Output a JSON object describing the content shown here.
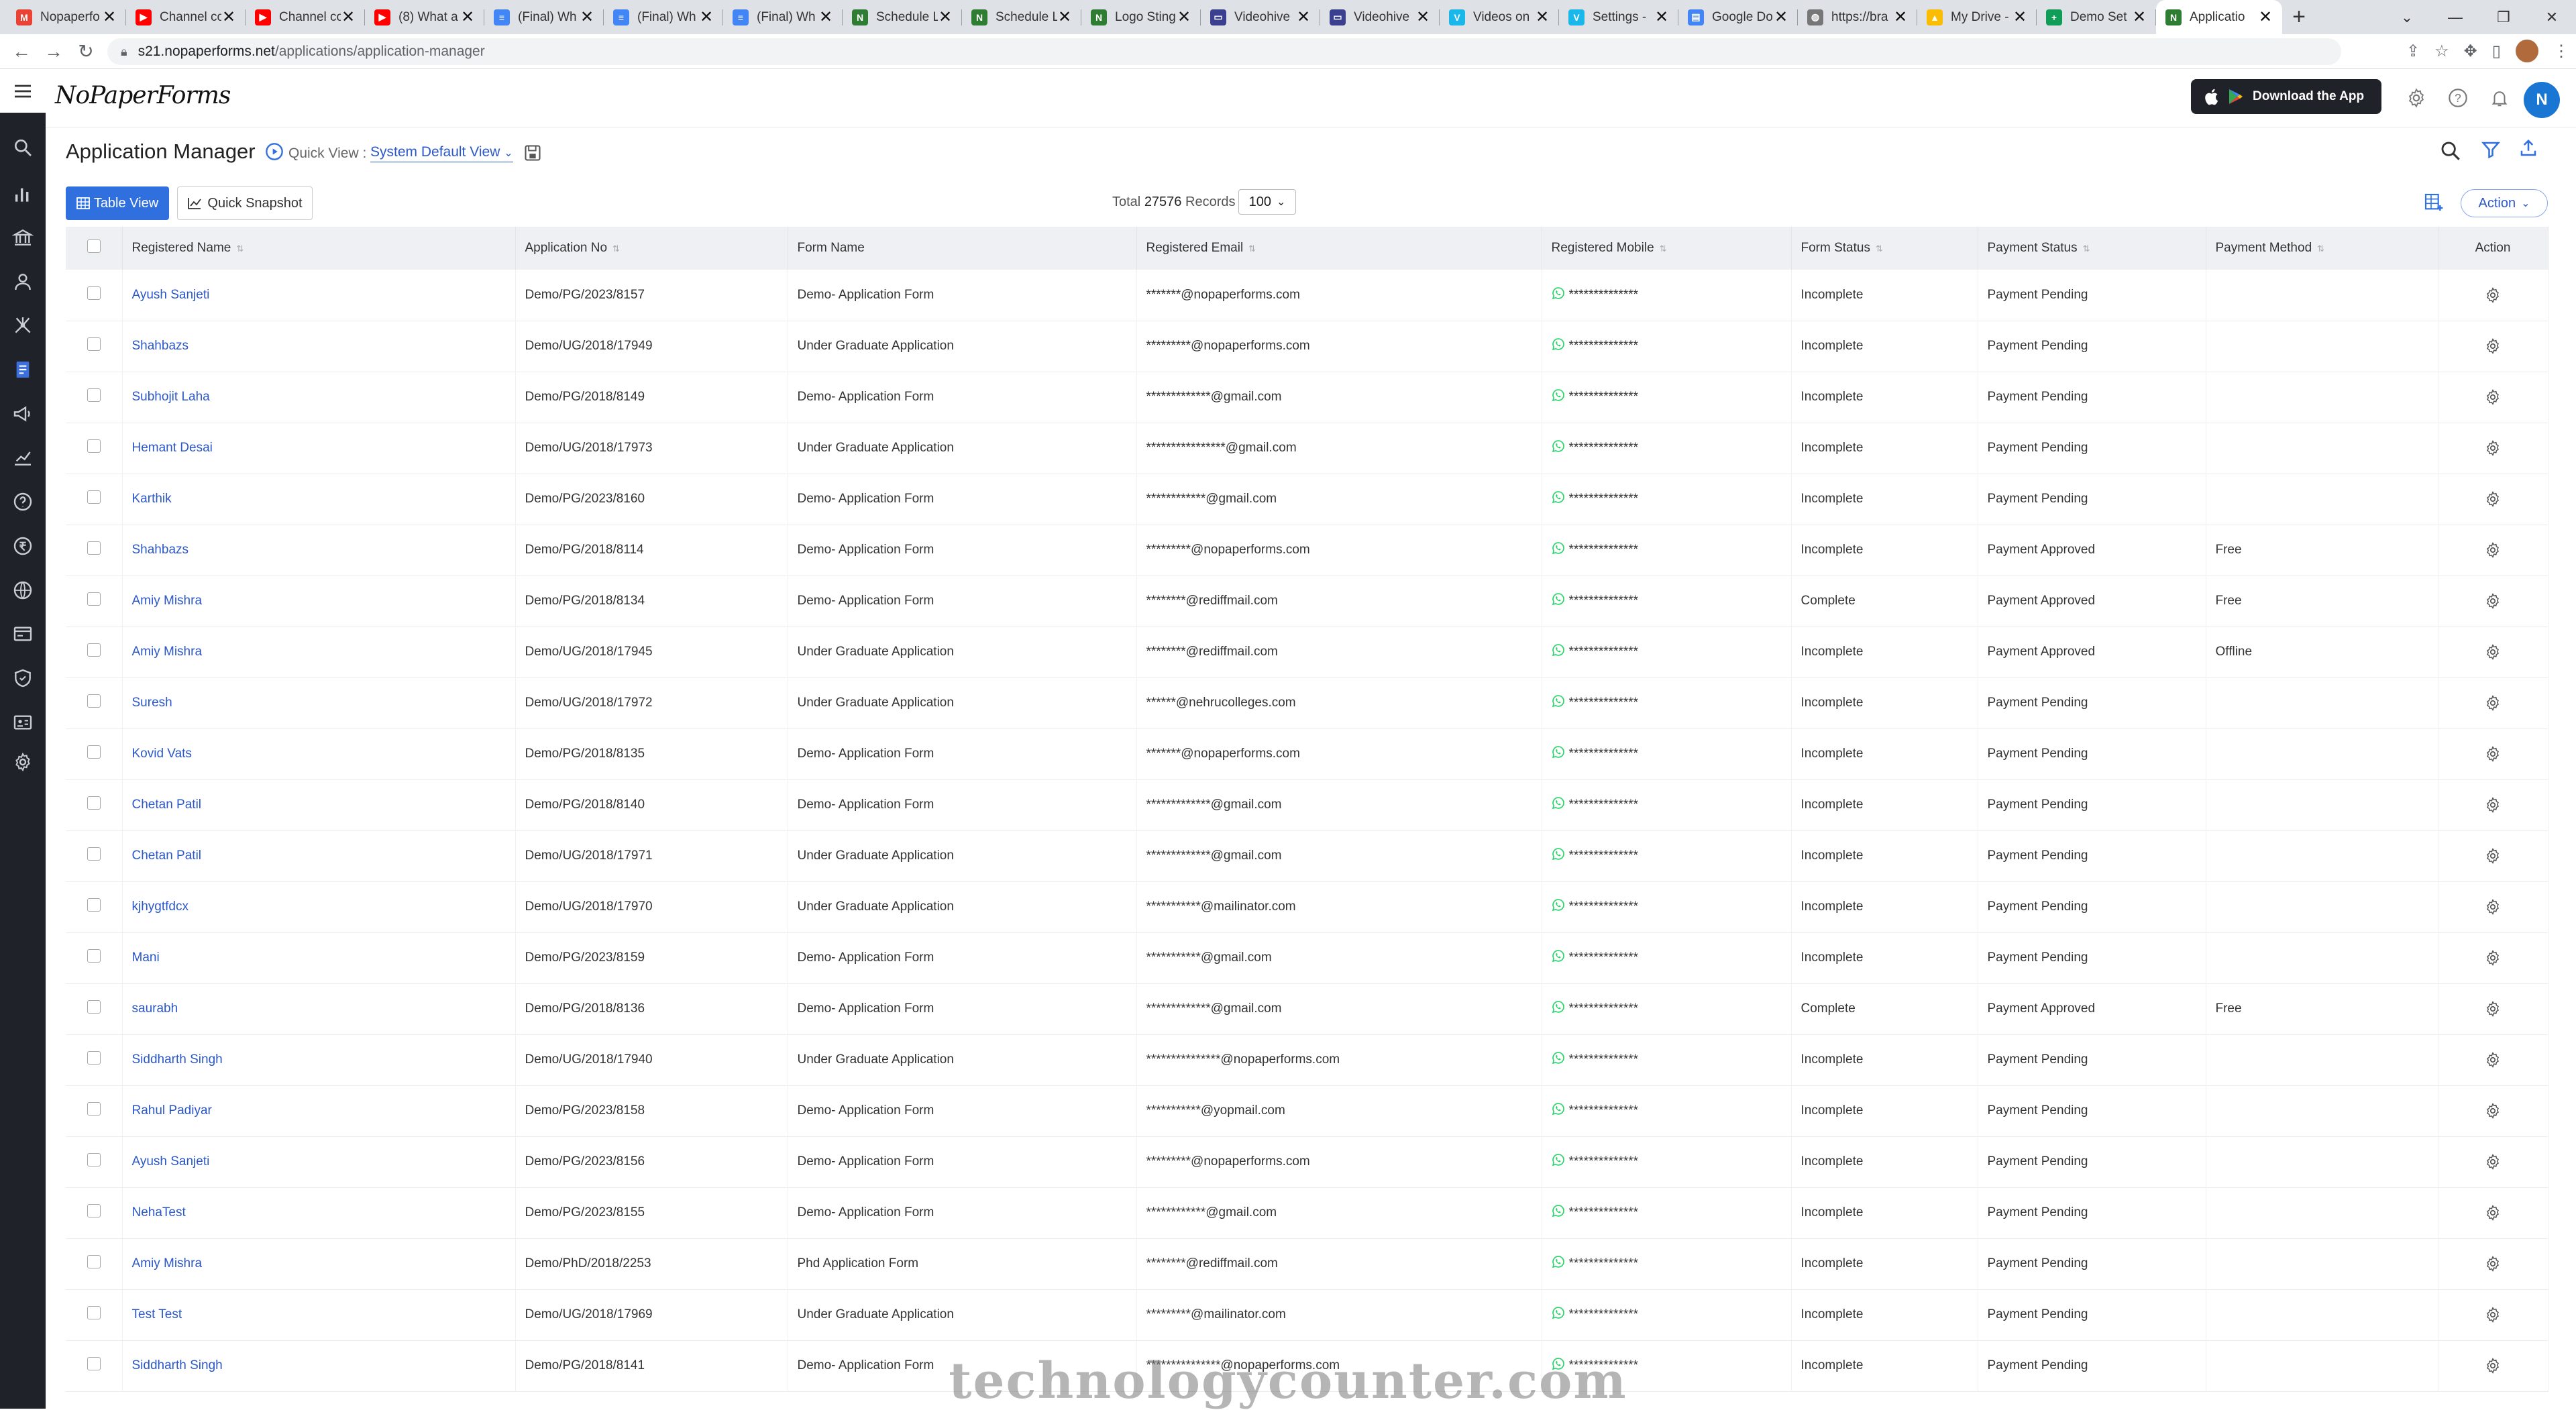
{
  "browser": {
    "tabs": [
      {
        "title": "Nopaperfo",
        "color": "#ea4335",
        "glyph": "M"
      },
      {
        "title": "Channel co",
        "color": "#ff0000",
        "glyph": "▶"
      },
      {
        "title": "Channel co",
        "color": "#ff0000",
        "glyph": "▶"
      },
      {
        "title": "(8) What a",
        "color": "#ff0000",
        "glyph": "▶"
      },
      {
        "title": "(Final) Wh",
        "color": "#4285f4",
        "glyph": "≡"
      },
      {
        "title": "(Final) Wh",
        "color": "#4285f4",
        "glyph": "≡"
      },
      {
        "title": "(Final) Wh",
        "color": "#4285f4",
        "glyph": "≡"
      },
      {
        "title": "Schedule L",
        "color": "#2e7d32",
        "glyph": "N"
      },
      {
        "title": "Schedule L",
        "color": "#2e7d32",
        "glyph": "N"
      },
      {
        "title": "Logo Sting",
        "color": "#2e7d32",
        "glyph": "N"
      },
      {
        "title": "Videohive",
        "color": "#3b3f8f",
        "glyph": "▭"
      },
      {
        "title": "Videohive",
        "color": "#3b3f8f",
        "glyph": "▭"
      },
      {
        "title": "Videos on",
        "color": "#1ab7ea",
        "glyph": "V"
      },
      {
        "title": "Settings -",
        "color": "#1ab7ea",
        "glyph": "V"
      },
      {
        "title": "Google Do",
        "color": "#4285f4",
        "glyph": "▤"
      },
      {
        "title": "https://bra",
        "color": "#777777",
        "glyph": "◍"
      },
      {
        "title": "My Drive -",
        "color": "#fbbc04",
        "glyph": "▲"
      },
      {
        "title": "Demo Set",
        "color": "#0f9d58",
        "glyph": "+"
      },
      {
        "title": "Applicatio",
        "color": "#2e7d32",
        "glyph": "N"
      }
    ],
    "close_glyph": "✕",
    "new_tab": "+",
    "window_controls": [
      "⌄",
      "—",
      "❐",
      "✕"
    ],
    "url_host": "s21.nopaperforms.net",
    "url_path": "/applications/application-manager"
  },
  "header": {
    "logo": "NoPaperForms",
    "download_label": "Download the App",
    "user_initial": "N"
  },
  "page": {
    "title": "Application Manager",
    "quick_view_label": "Quick View :",
    "quick_view_value": "System Default View"
  },
  "toolbar": {
    "table_view": "Table View",
    "quick_snapshot": "Quick Snapshot",
    "total_prefix": "Total",
    "total_count": "27576",
    "total_suffix": "Records",
    "per_page": "100",
    "action": "Action"
  },
  "table": {
    "columns": [
      "Registered Name",
      "Application No",
      "Form Name",
      "Registered Email",
      "Registered Mobile",
      "Form Status",
      "Payment Status",
      "Payment Method",
      "Action"
    ],
    "rows": [
      [
        "Ayush Sanjeti",
        "Demo/PG/2023/8157",
        "Demo- Application Form",
        "*******@nopaperforms.com",
        "**************",
        "Incomplete",
        "Payment Pending",
        ""
      ],
      [
        "Shahbazs",
        "Demo/UG/2018/17949",
        "Under Graduate Application",
        "*********@nopaperforms.com",
        "**************",
        "Incomplete",
        "Payment Pending",
        ""
      ],
      [
        "Subhojit Laha",
        "Demo/PG/2018/8149",
        "Demo- Application Form",
        "*************@gmail.com",
        "**************",
        "Incomplete",
        "Payment Pending",
        ""
      ],
      [
        "Hemant Desai",
        "Demo/UG/2018/17973",
        "Under Graduate Application",
        "****************@gmail.com",
        "**************",
        "Incomplete",
        "Payment Pending",
        ""
      ],
      [
        "Karthik",
        "Demo/PG/2023/8160",
        "Demo- Application Form",
        "************@gmail.com",
        "**************",
        "Incomplete",
        "Payment Pending",
        ""
      ],
      [
        "Shahbazs",
        "Demo/PG/2018/8114",
        "Demo- Application Form",
        "*********@nopaperforms.com",
        "**************",
        "Incomplete",
        "Payment Approved",
        "Free"
      ],
      [
        "Amiy Mishra",
        "Demo/PG/2018/8134",
        "Demo- Application Form",
        "********@rediffmail.com",
        "**************",
        "Complete",
        "Payment Approved",
        "Free"
      ],
      [
        "Amiy Mishra",
        "Demo/UG/2018/17945",
        "Under Graduate Application",
        "********@rediffmail.com",
        "**************",
        "Incomplete",
        "Payment Approved",
        "Offline"
      ],
      [
        "Suresh",
        "Demo/UG/2018/17972",
        "Under Graduate Application",
        "******@nehrucolleges.com",
        "**************",
        "Incomplete",
        "Payment Pending",
        ""
      ],
      [
        "Kovid Vats",
        "Demo/PG/2018/8135",
        "Demo- Application Form",
        "*******@nopaperforms.com",
        "**************",
        "Incomplete",
        "Payment Pending",
        ""
      ],
      [
        "Chetan Patil",
        "Demo/PG/2018/8140",
        "Demo- Application Form",
        "*************@gmail.com",
        "**************",
        "Incomplete",
        "Payment Pending",
        ""
      ],
      [
        "Chetan Patil",
        "Demo/UG/2018/17971",
        "Under Graduate Application",
        "*************@gmail.com",
        "**************",
        "Incomplete",
        "Payment Pending",
        ""
      ],
      [
        "kjhygtfdcx",
        "Demo/UG/2018/17970",
        "Under Graduate Application",
        "***********@mailinator.com",
        "**************",
        "Incomplete",
        "Payment Pending",
        ""
      ],
      [
        "Mani",
        "Demo/PG/2023/8159",
        "Demo- Application Form",
        "***********@gmail.com",
        "**************",
        "Incomplete",
        "Payment Pending",
        ""
      ],
      [
        "saurabh",
        "Demo/PG/2018/8136",
        "Demo- Application Form",
        "*************@gmail.com",
        "**************",
        "Complete",
        "Payment Approved",
        "Free"
      ],
      [
        "Siddharth Singh",
        "Demo/UG/2018/17940",
        "Under Graduate Application",
        "***************@nopaperforms.com",
        "**************",
        "Incomplete",
        "Payment Pending",
        ""
      ],
      [
        "Rahul Padiyar",
        "Demo/PG/2023/8158",
        "Demo- Application Form",
        "***********@yopmail.com",
        "**************",
        "Incomplete",
        "Payment Pending",
        ""
      ],
      [
        "Ayush Sanjeti",
        "Demo/PG/2023/8156",
        "Demo- Application Form",
        "*********@nopaperforms.com",
        "**************",
        "Incomplete",
        "Payment Pending",
        ""
      ],
      [
        "NehaTest",
        "Demo/PG/2023/8155",
        "Demo- Application Form",
        "************@gmail.com",
        "**************",
        "Incomplete",
        "Payment Pending",
        ""
      ],
      [
        "Amiy Mishra",
        "Demo/PhD/2018/2253",
        "Phd Application Form",
        "********@rediffmail.com",
        "**************",
        "Incomplete",
        "Payment Pending",
        ""
      ],
      [
        "Test Test",
        "Demo/UG/2018/17969",
        "Under Graduate Application",
        "*********@mailinator.com",
        "**************",
        "Incomplete",
        "Payment Pending",
        ""
      ],
      [
        "Siddharth Singh",
        "Demo/PG/2018/8141",
        "Demo- Application Form",
        "***************@nopaperforms.com",
        "**************",
        "Incomplete",
        "Payment Pending",
        ""
      ]
    ]
  },
  "watermark": "technologycounter.com",
  "icons": {
    "sidebar": [
      "hamburger-icon",
      "search-icon",
      "bar-chart-icon",
      "institution-icon",
      "person-icon",
      "network-icon",
      "applications-icon",
      "megaphone-icon",
      "analytics-icon",
      "help-icon",
      "rupee-icon",
      "globe-icon",
      "billing-icon",
      "shield-icon",
      "id-card-icon",
      "settings-icon"
    ],
    "row_action": "gear-icon",
    "mobile": "whatsapp-icon"
  },
  "colors": {
    "primary": "#2f6fde",
    "link": "#2b57c7",
    "sidebar": "#1f2228",
    "avatar": "#1976d2",
    "whatsapp": "#25d366"
  }
}
